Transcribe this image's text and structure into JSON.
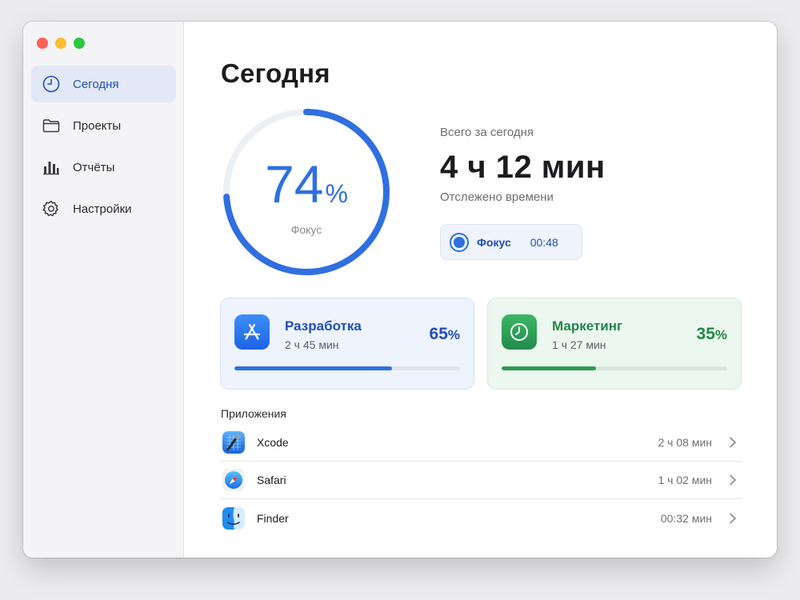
{
  "sidebar": {
    "items": [
      {
        "label": "Сегодня",
        "icon": "clock-icon",
        "active": true
      },
      {
        "label": "Проекты",
        "icon": "folder-icon"
      },
      {
        "label": "Отчёты",
        "icon": "bar-chart-icon"
      },
      {
        "label": "Настройки",
        "icon": "gear-icon"
      }
    ]
  },
  "main": {
    "title": "Сегодня",
    "focus_ring": {
      "value": "74",
      "unit": "%",
      "label": "Фокус",
      "fraction": 0.74,
      "color": "#2f6fe0"
    },
    "total": {
      "caption": "Всего за сегодня",
      "value": "4 ч 12 мин",
      "subtitle": "Отслежено времени"
    },
    "focus_chip": {
      "label": "Фокус",
      "time": "00:48"
    },
    "projects": [
      {
        "name": "Разработка",
        "time": "2 ч 45 мин",
        "percent": "65",
        "unit": "%",
        "fraction": 0.7,
        "icon": "app-store-icon",
        "color": "#1f4fb8"
      },
      {
        "name": "Маркетинг",
        "time": "1 ч 27 мин",
        "percent": "35",
        "unit": "%",
        "fraction": 0.42,
        "icon": "clock-icon",
        "color": "#23874a"
      }
    ],
    "apps_heading": "Приложения",
    "apps": [
      {
        "name": "Xcode",
        "time": "2 ч 08 мин",
        "icon": "xcode-icon"
      },
      {
        "name": "Safari",
        "time": "1 ч 02 мин",
        "icon": "safari-icon"
      },
      {
        "name": "Finder",
        "time": "00:32 мин",
        "icon": "finder-icon"
      }
    ]
  }
}
